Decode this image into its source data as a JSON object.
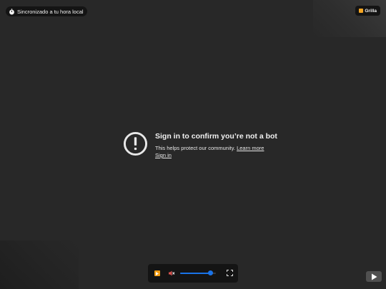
{
  "sync_badge": {
    "label": "Sincronizado a tu hora local",
    "icon": "stopwatch-icon"
  },
  "grid_badge": {
    "label": "Grilla",
    "icon": "grid-icon",
    "icon_color": "#f5a623"
  },
  "message": {
    "title": "Sign in to confirm you’re not a bot",
    "body": "This helps protect our community.",
    "learn_more": "Learn more",
    "sign_in": "Sign in",
    "icon": "exclamation-circle-icon"
  },
  "player": {
    "play_icon": "play-icon",
    "mute_icon": "speaker-muted-icon",
    "volume": 0.84,
    "fullscreen_icon": "fullscreen-icon",
    "accent": "#1a73e8",
    "play_color": "#f39c12"
  },
  "youtube_button": {
    "icon": "youtube-play-icon"
  }
}
